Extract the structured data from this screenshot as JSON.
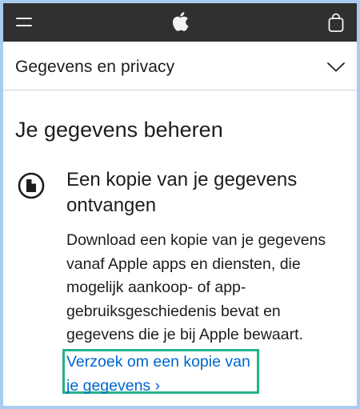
{
  "header": {
    "menu_icon": "hamburger-menu-icon",
    "logo_icon": "apple-logo-icon",
    "bag_icon": "shopping-bag-icon"
  },
  "subnav": {
    "title": "Gegevens en privacy",
    "toggle_icon": "chevron-down-icon"
  },
  "main": {
    "section_title": "Je gegevens beheren",
    "card": {
      "icon": "document-icon",
      "heading": "Een kopie van je gegevens ontvangen",
      "body": "Download een kopie van je gegevens vanaf Apple apps en diensten, die mogelijk aankoop- of app-gebruiksgeschiedenis bevat en gegevens die je bij Apple bewaart.",
      "link_text": "Verzoek om een kopie van je gegevens ›"
    }
  },
  "colors": {
    "nav_background": "#303030",
    "link": "#0066cc",
    "highlight_border": "#22b38a",
    "page_background": "#a8ccf0"
  }
}
